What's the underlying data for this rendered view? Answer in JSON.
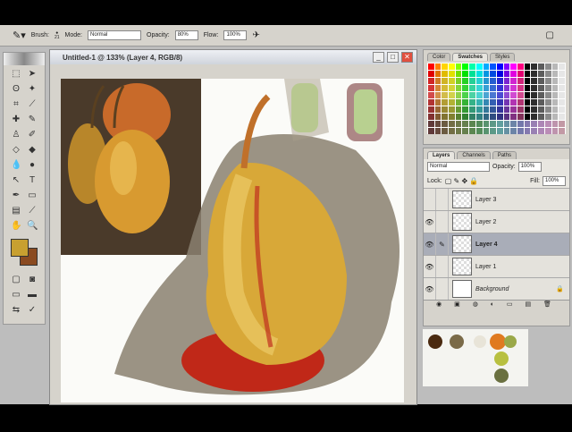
{
  "options": {
    "brush_label": "Brush:",
    "brush_size": "21",
    "mode_label": "Mode:",
    "mode_value": "Normal",
    "opacity_label": "Opacity:",
    "opacity_value": "80%",
    "flow_label": "Flow:",
    "flow_value": "100%"
  },
  "document": {
    "title": "Untitled-1 @ 133% (Layer 4, RGB/8)"
  },
  "swatches_panel": {
    "tabs": [
      "Color",
      "Swatches",
      "Styles"
    ],
    "active_tab": "Swatches"
  },
  "layers_panel": {
    "tabs": [
      "Layers",
      "Channels",
      "Paths"
    ],
    "blend_mode": "Normal",
    "opacity_label": "Opacity:",
    "opacity_value": "100%",
    "lock_label": "Lock:",
    "fill_label": "Fill:",
    "fill_value": "100%",
    "layers": [
      {
        "name": "Layer 3",
        "visible": false,
        "selected": false
      },
      {
        "name": "Layer 2",
        "visible": true,
        "selected": false
      },
      {
        "name": "Layer 4",
        "visible": true,
        "selected": true
      },
      {
        "name": "Layer 1",
        "visible": true,
        "selected": false
      },
      {
        "name": "Background",
        "visible": true,
        "selected": false,
        "locked": true
      }
    ]
  },
  "colors": {
    "foreground": "#c8a030",
    "background": "#8a4a20",
    "mixer": [
      "#4a2a10",
      "#7a6a48",
      "#e8e4d8",
      "#e07a20",
      "#b8c040",
      "#9aa848",
      "#6a7040"
    ]
  }
}
